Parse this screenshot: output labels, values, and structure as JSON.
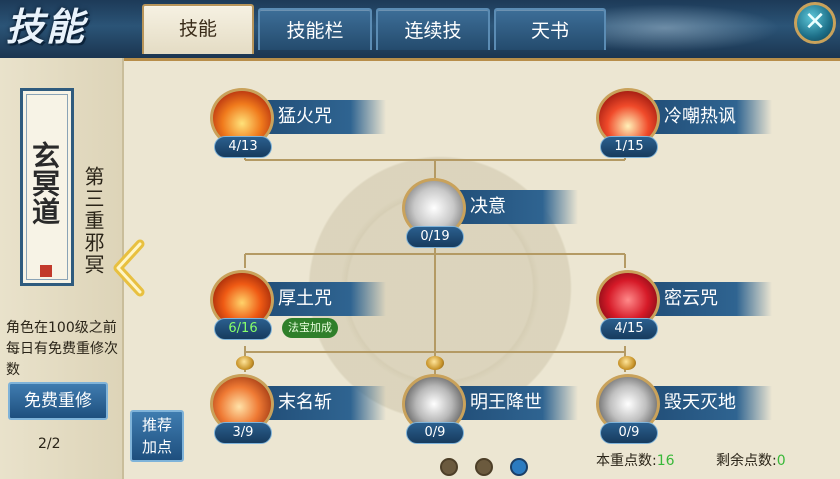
{
  "header": {
    "logo_text": "技能",
    "tabs": [
      {
        "label": "技能",
        "active": true
      },
      {
        "label": "技能栏",
        "active": false
      },
      {
        "label": "连续技",
        "active": false
      },
      {
        "label": "天书",
        "active": false
      }
    ],
    "close_icon": "close-icon"
  },
  "sidebar": {
    "scroll_text": "玄冥道",
    "tier_label": "第三重邪冥",
    "note": "角色在100级之前每日有免费重修次数",
    "free_button": "免费重修",
    "free_count": "2/2"
  },
  "recommend_button": "推荐加点",
  "skills": [
    {
      "name": "猛火咒",
      "level": "4/13",
      "icon": "fire-spell-icon"
    },
    {
      "name": "冷嘲热讽",
      "level": "1/15",
      "icon": "taunt-icon"
    },
    {
      "name": "决意",
      "level": "0/19",
      "icon": "resolve-shield-icon"
    },
    {
      "name": "厚土咒",
      "level": "6/16",
      "icon": "earth-spell-icon",
      "badge": "法宝加成"
    },
    {
      "name": "密云咒",
      "level": "4/15",
      "icon": "cloud-shield-icon"
    },
    {
      "name": "末名斩",
      "level": "3/9",
      "icon": "slash-icon"
    },
    {
      "name": "明王降世",
      "level": "0/9",
      "icon": "wisdom-king-icon"
    },
    {
      "name": "毁天灭地",
      "level": "0/9",
      "icon": "destruction-icon"
    }
  ],
  "footer": {
    "page_dots": 3,
    "active_page": 3,
    "reset_points_label": "本重点数:",
    "reset_points_value": "16",
    "remaining_points_label": "剩余点数:",
    "remaining_points_value": "0"
  },
  "colors": {
    "header_blue": "#244b6d",
    "panel_parchment": "#ece6d2",
    "gold_frame": "#c9a25b",
    "points_green": "#38b838"
  }
}
